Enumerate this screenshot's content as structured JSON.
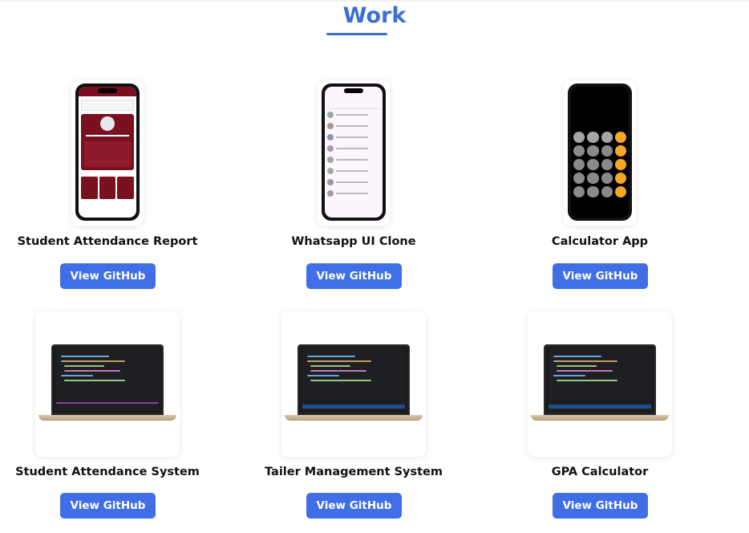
{
  "section": {
    "title": "Work"
  },
  "button_label": "View GitHub",
  "projects": [
    {
      "name": "Student Attendance Report",
      "thumb": "phone-attendance"
    },
    {
      "name": "Whatsapp UI Clone",
      "thumb": "phone-whatsapp"
    },
    {
      "name": "Calculator App",
      "thumb": "phone-calculator"
    },
    {
      "name": "Student Attendance System",
      "thumb": "laptop-code"
    },
    {
      "name": "Tailer Management System",
      "thumb": "laptop-code"
    },
    {
      "name": "GPA Calculator",
      "thumb": "laptop-code"
    }
  ],
  "colors": {
    "accent": "#3b6fd6",
    "button": "#3f6ee6",
    "maroon": "#7a1020",
    "calc_orange": "#f5a623"
  }
}
